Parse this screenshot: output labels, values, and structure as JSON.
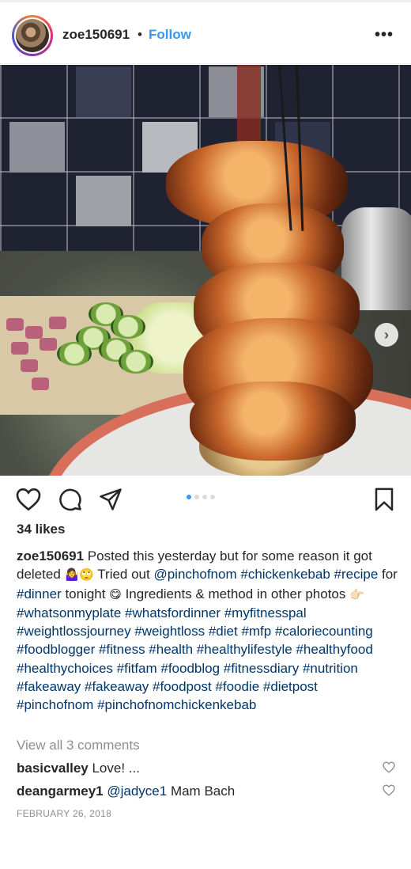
{
  "header": {
    "username": "zoe150691",
    "separator": "•",
    "follow_label": "Follow",
    "more_label": "•••"
  },
  "post": {
    "carousel": {
      "total": 4,
      "current": 1
    },
    "next_label": "›"
  },
  "likes": "34 likes",
  "caption": {
    "author": "zoe150691",
    "t1": " Posted this yesterday but for some reason it got deleted ",
    "e1": "🤷‍♀️🙄",
    "t2": " Tried out ",
    "h_pinchofnom": "@pinchofnom",
    "h_chickenkebab": "#chickenkebab",
    "h_recipe": "#recipe",
    "t3": " for ",
    "h_dinner": "#dinner",
    "t4": " tonight ",
    "e2": "😋",
    "t5": " Ingredients & method in other photos ",
    "e3": "👉🏻",
    "tags_rest": "#whatsonmyplate #whatsfordinner #myfitnesspal #weightlossjourney #weightloss #diet #mfp #caloriecounting #foodblogger #fitness #health #healthylifestyle #healthyfood #healthychoices #fitfam #foodblog #fitnessdiary #nutrition #fakeaway #fakeaway #foodpost #foodie #dietpost #pinchofnom #pinchofnomchickenkebab"
  },
  "view_all": "View all 3 comments",
  "comments": [
    {
      "user": "basicvalley",
      "text": " Love! ..."
    },
    {
      "user": "deangarmey1",
      "mention": "@jadyce1",
      "text": " Mam Bach"
    }
  ],
  "date": "FEBRUARY 26, 2018",
  "colors": {
    "link": "#3897f0",
    "hashtag": "#003569",
    "muted": "#8e8e8e"
  },
  "icons": [
    "heart-icon",
    "comment-icon",
    "share-icon",
    "bookmark-icon",
    "user-tag-icon",
    "chevron-right-icon",
    "more-icon"
  ]
}
